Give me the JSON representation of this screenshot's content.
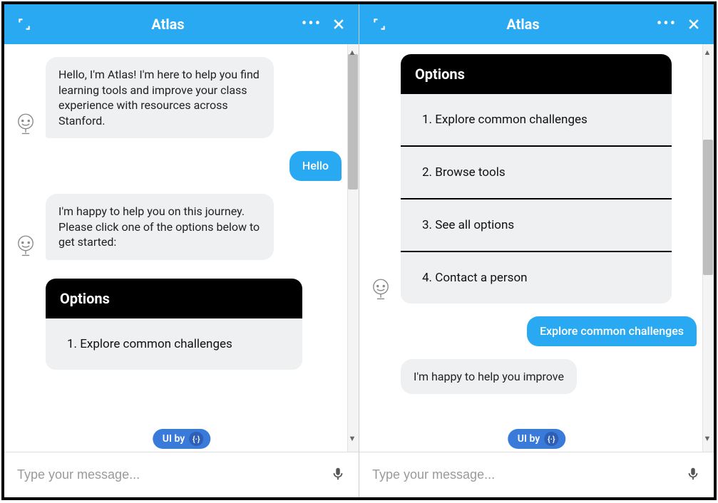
{
  "panels": [
    {
      "title": "Atlas",
      "messages": {
        "bot1": "Hello, I'm Atlas! I'm here to help you find learning tools and improve your class experience with resources across Stanford.",
        "user1": "Hello",
        "bot2": "I'm happy to help you on this journey. Please click one of the options below to get started:"
      },
      "options_title": "Options",
      "options": [
        "1. Explore common challenges"
      ],
      "input_placeholder": "Type your message...",
      "ui_by": "UI by"
    },
    {
      "title": "Atlas",
      "options_title": "Options",
      "options": [
        "1. Explore common challenges",
        "2. Browse tools",
        "3. See all options",
        "4. Contact a person"
      ],
      "messages": {
        "user1": "Explore common challenges",
        "bot1": "I'm happy to help you improve"
      },
      "input_placeholder": "Type your message...",
      "ui_by": "UI by"
    }
  ],
  "icons": {
    "expand": "expand-icon",
    "more": "more-icon",
    "close": "close-icon",
    "mic": "mic-icon",
    "bot": "bot-avatar-icon"
  }
}
